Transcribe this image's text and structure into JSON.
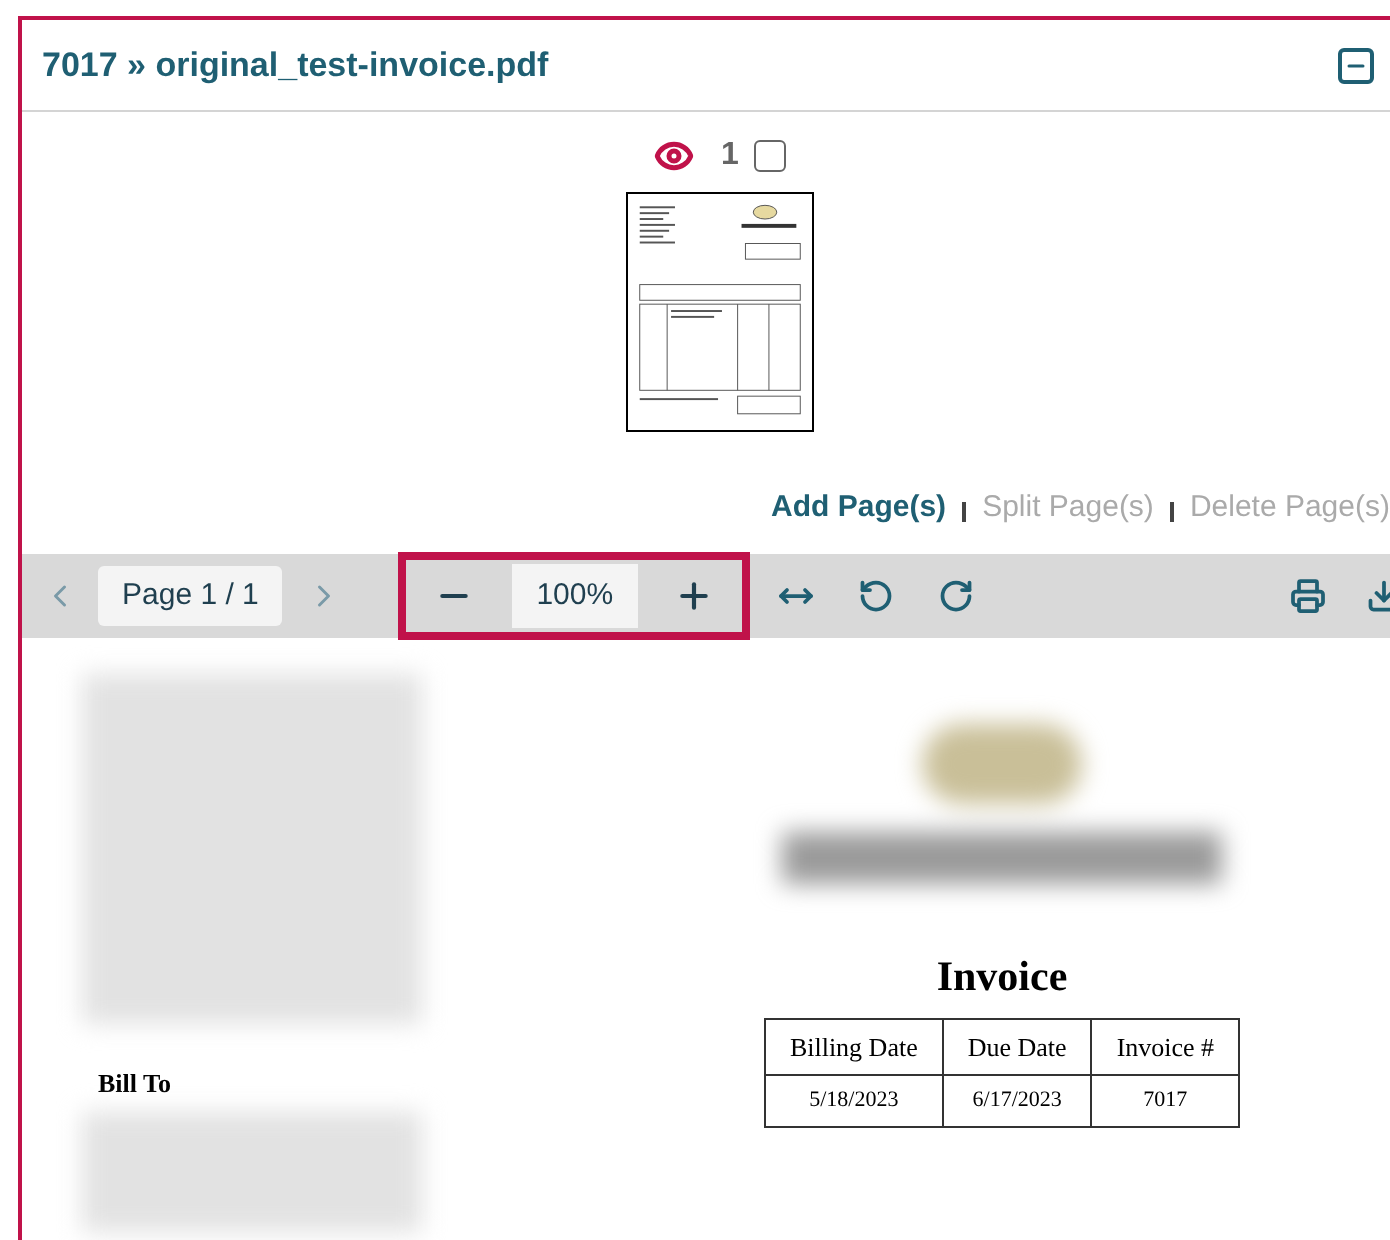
{
  "panel": {
    "title": "7017 » original_test-invoice.pdf",
    "collapsed": false
  },
  "thumbnails": [
    {
      "page_number": "1",
      "viewing": true,
      "checked": false
    }
  ],
  "page_actions": [
    {
      "label": "Add Page(s)",
      "disabled": false
    },
    {
      "label": "Split Page(s)",
      "disabled": true
    },
    {
      "label": "Delete Page(s)",
      "disabled": true
    }
  ],
  "toolbar": {
    "page_indicator": "Page 1 / 1",
    "zoom": "100%"
  },
  "document": {
    "title": "Invoice",
    "bill_to_label": "Bill To",
    "table": {
      "columns": [
        "Billing Date",
        "Due Date",
        "Invoice #"
      ],
      "rows": [
        [
          "5/18/2023",
          "6/17/2023",
          "7017"
        ]
      ]
    }
  }
}
